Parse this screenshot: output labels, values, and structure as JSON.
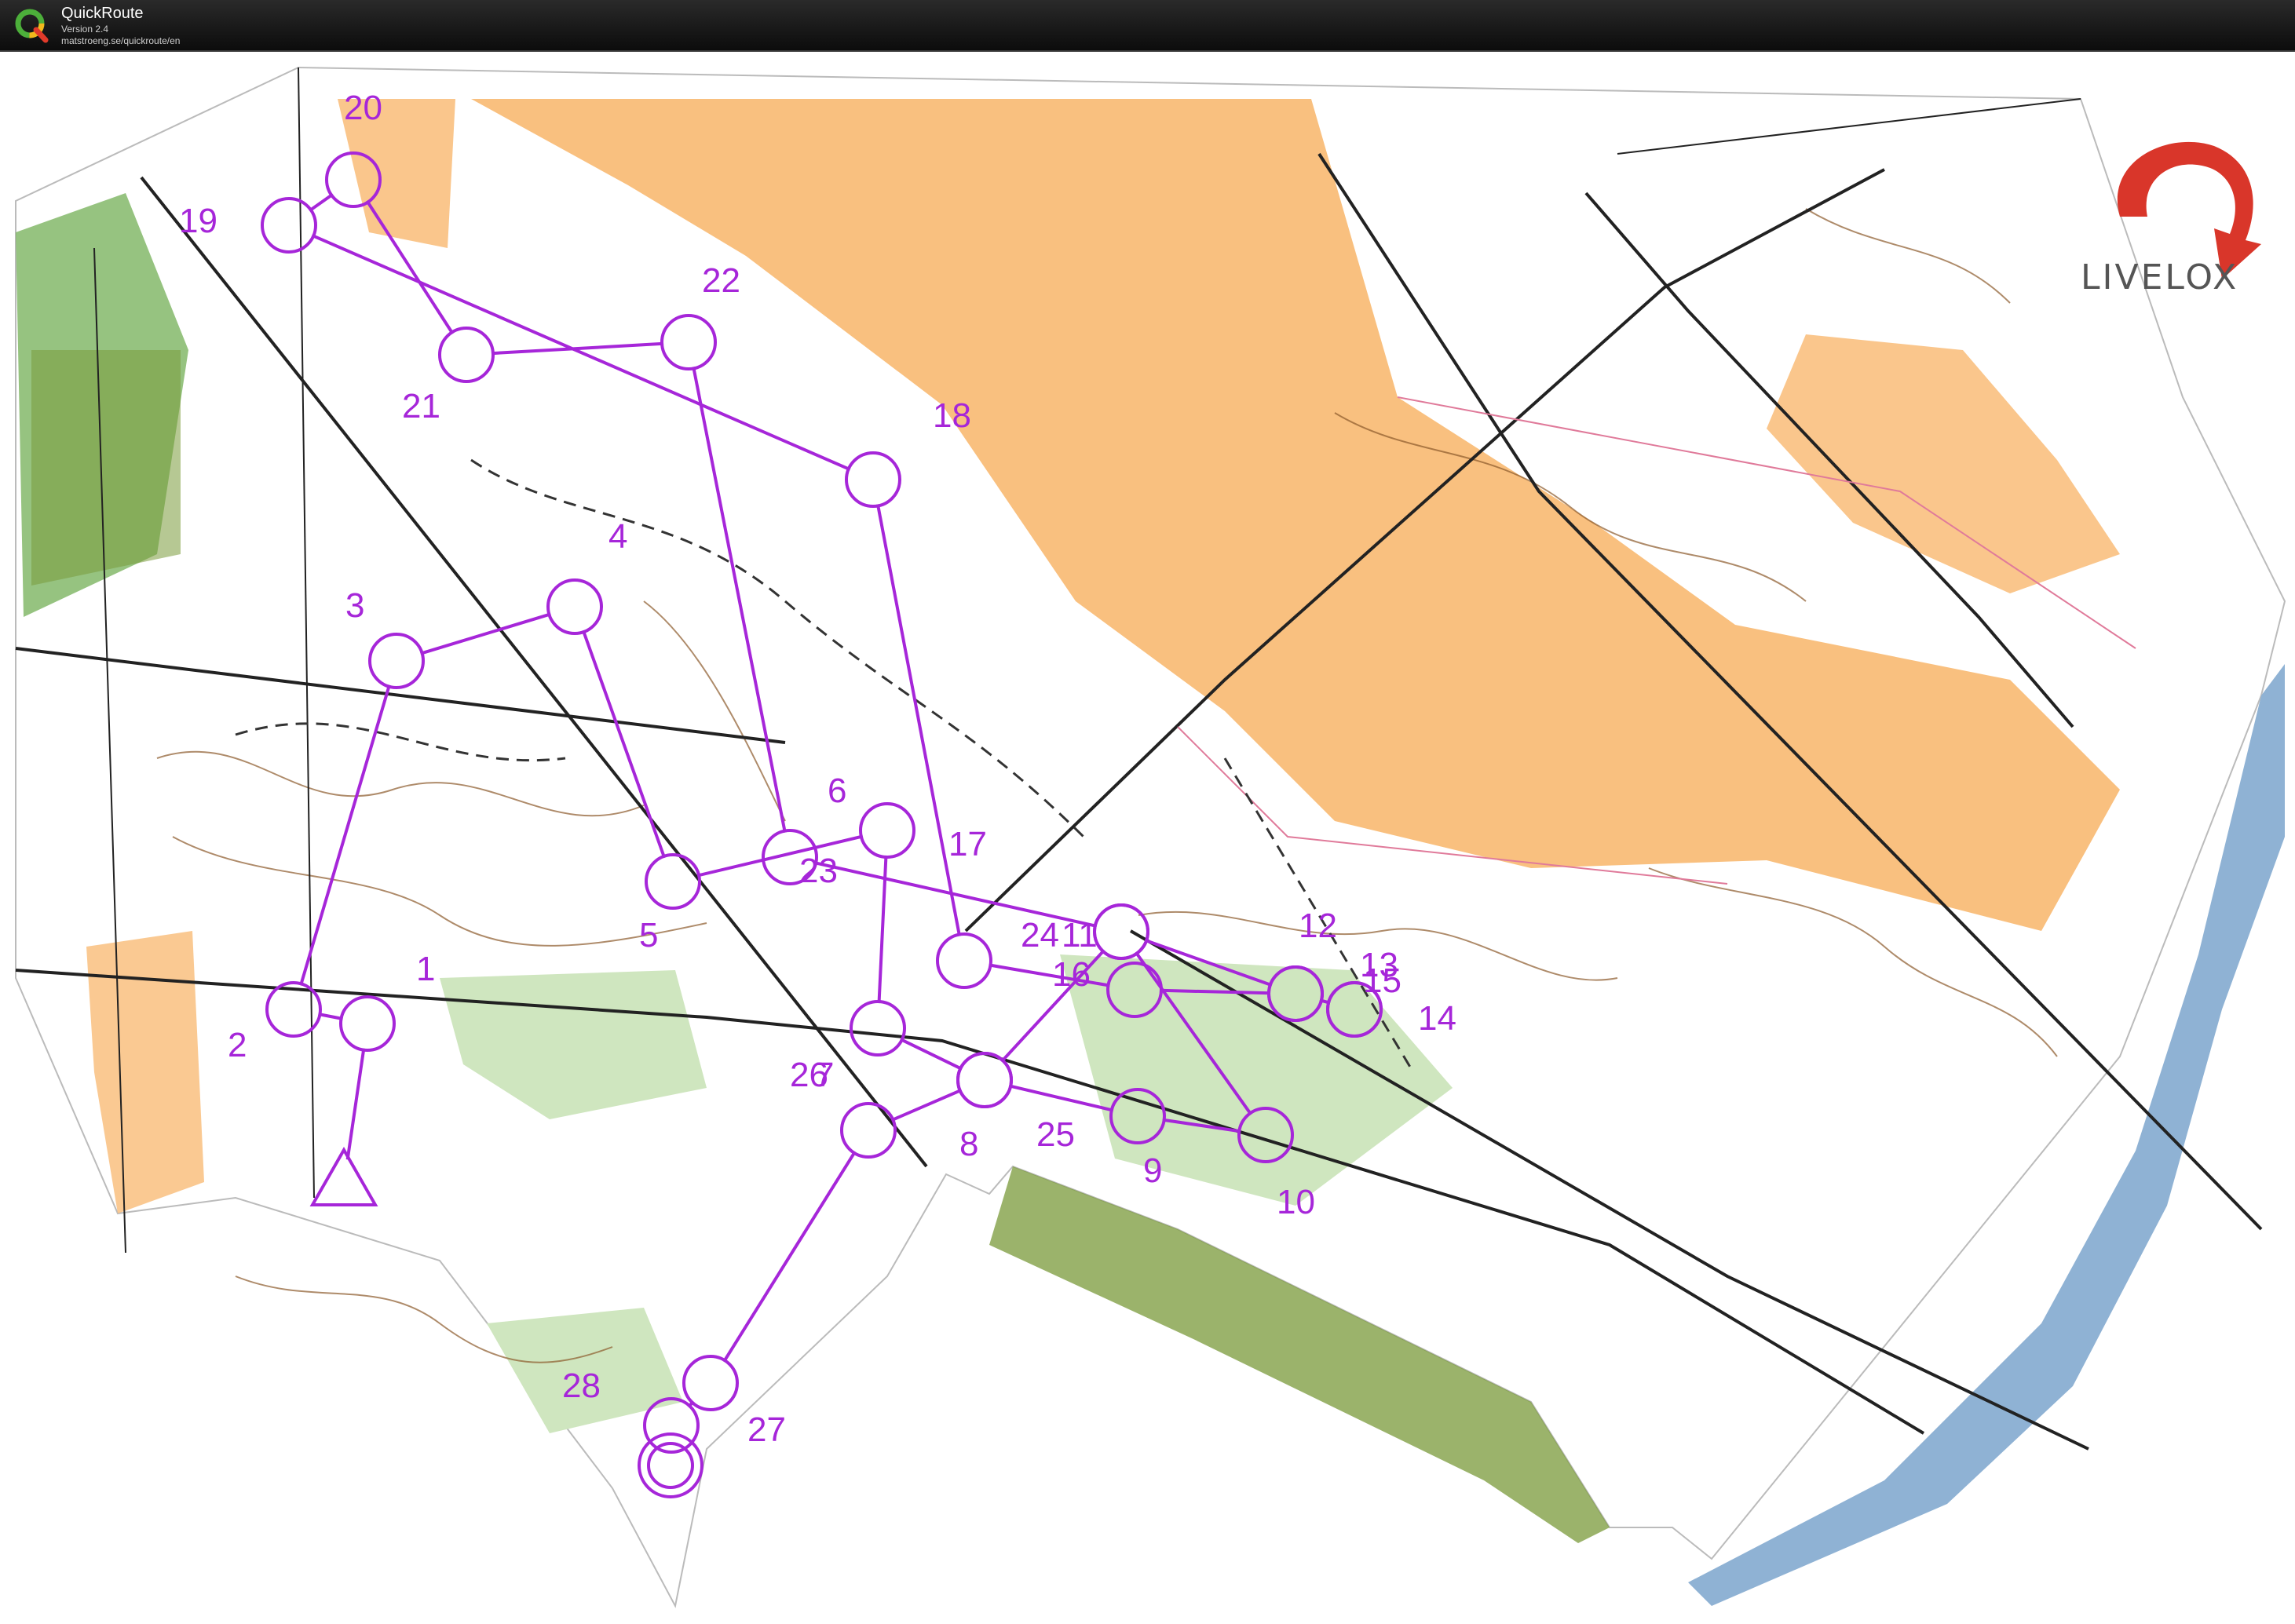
{
  "app": {
    "title": "QuickRoute",
    "version": "Version 2.4",
    "url": "matstroeng.se/quickroute/en"
  },
  "brand": {
    "name": "LIVELOX",
    "icon": "livelox-arrow-icon"
  },
  "colors": {
    "course": "#a626d9",
    "open_land": "#f9c07f",
    "rough_open": "#fbd9ad",
    "forest_green": "#84b86a",
    "light_green": "#cfe6bf",
    "settlement": "#7a9a3a",
    "water": "#8fb2d4",
    "contour": "#8c5a2b",
    "titlebar": "#111111"
  },
  "course": {
    "start": {
      "label": "start"
    },
    "controls": [
      {
        "n": "1",
        "label": "1"
      },
      {
        "n": "2",
        "label": "2"
      },
      {
        "n": "3",
        "label": "3"
      },
      {
        "n": "4",
        "label": "4"
      },
      {
        "n": "5",
        "label": "5"
      },
      {
        "n": "6",
        "label": "6"
      },
      {
        "n": "7",
        "label": "7"
      },
      {
        "n": "8",
        "label": "8"
      },
      {
        "n": "9",
        "label": "9"
      },
      {
        "n": "10",
        "label": "10"
      },
      {
        "n": "11",
        "label": "11"
      },
      {
        "n": "12",
        "label": "12"
      },
      {
        "n": "13",
        "label": "13"
      },
      {
        "n": "14",
        "label": "14"
      },
      {
        "n": "15",
        "label": "15"
      },
      {
        "n": "16",
        "label": "16"
      },
      {
        "n": "17",
        "label": "17"
      },
      {
        "n": "18",
        "label": "18"
      },
      {
        "n": "19",
        "label": "19"
      },
      {
        "n": "20",
        "label": "20"
      },
      {
        "n": "21",
        "label": "21"
      },
      {
        "n": "22",
        "label": "22"
      },
      {
        "n": "23",
        "label": "23"
      },
      {
        "n": "24",
        "label": "24"
      },
      {
        "n": "25",
        "label": "25"
      },
      {
        "n": "26",
        "label": "26"
      },
      {
        "n": "27",
        "label": "27"
      },
      {
        "n": "28",
        "label": "28"
      }
    ],
    "finish": {
      "label": "finish"
    }
  }
}
